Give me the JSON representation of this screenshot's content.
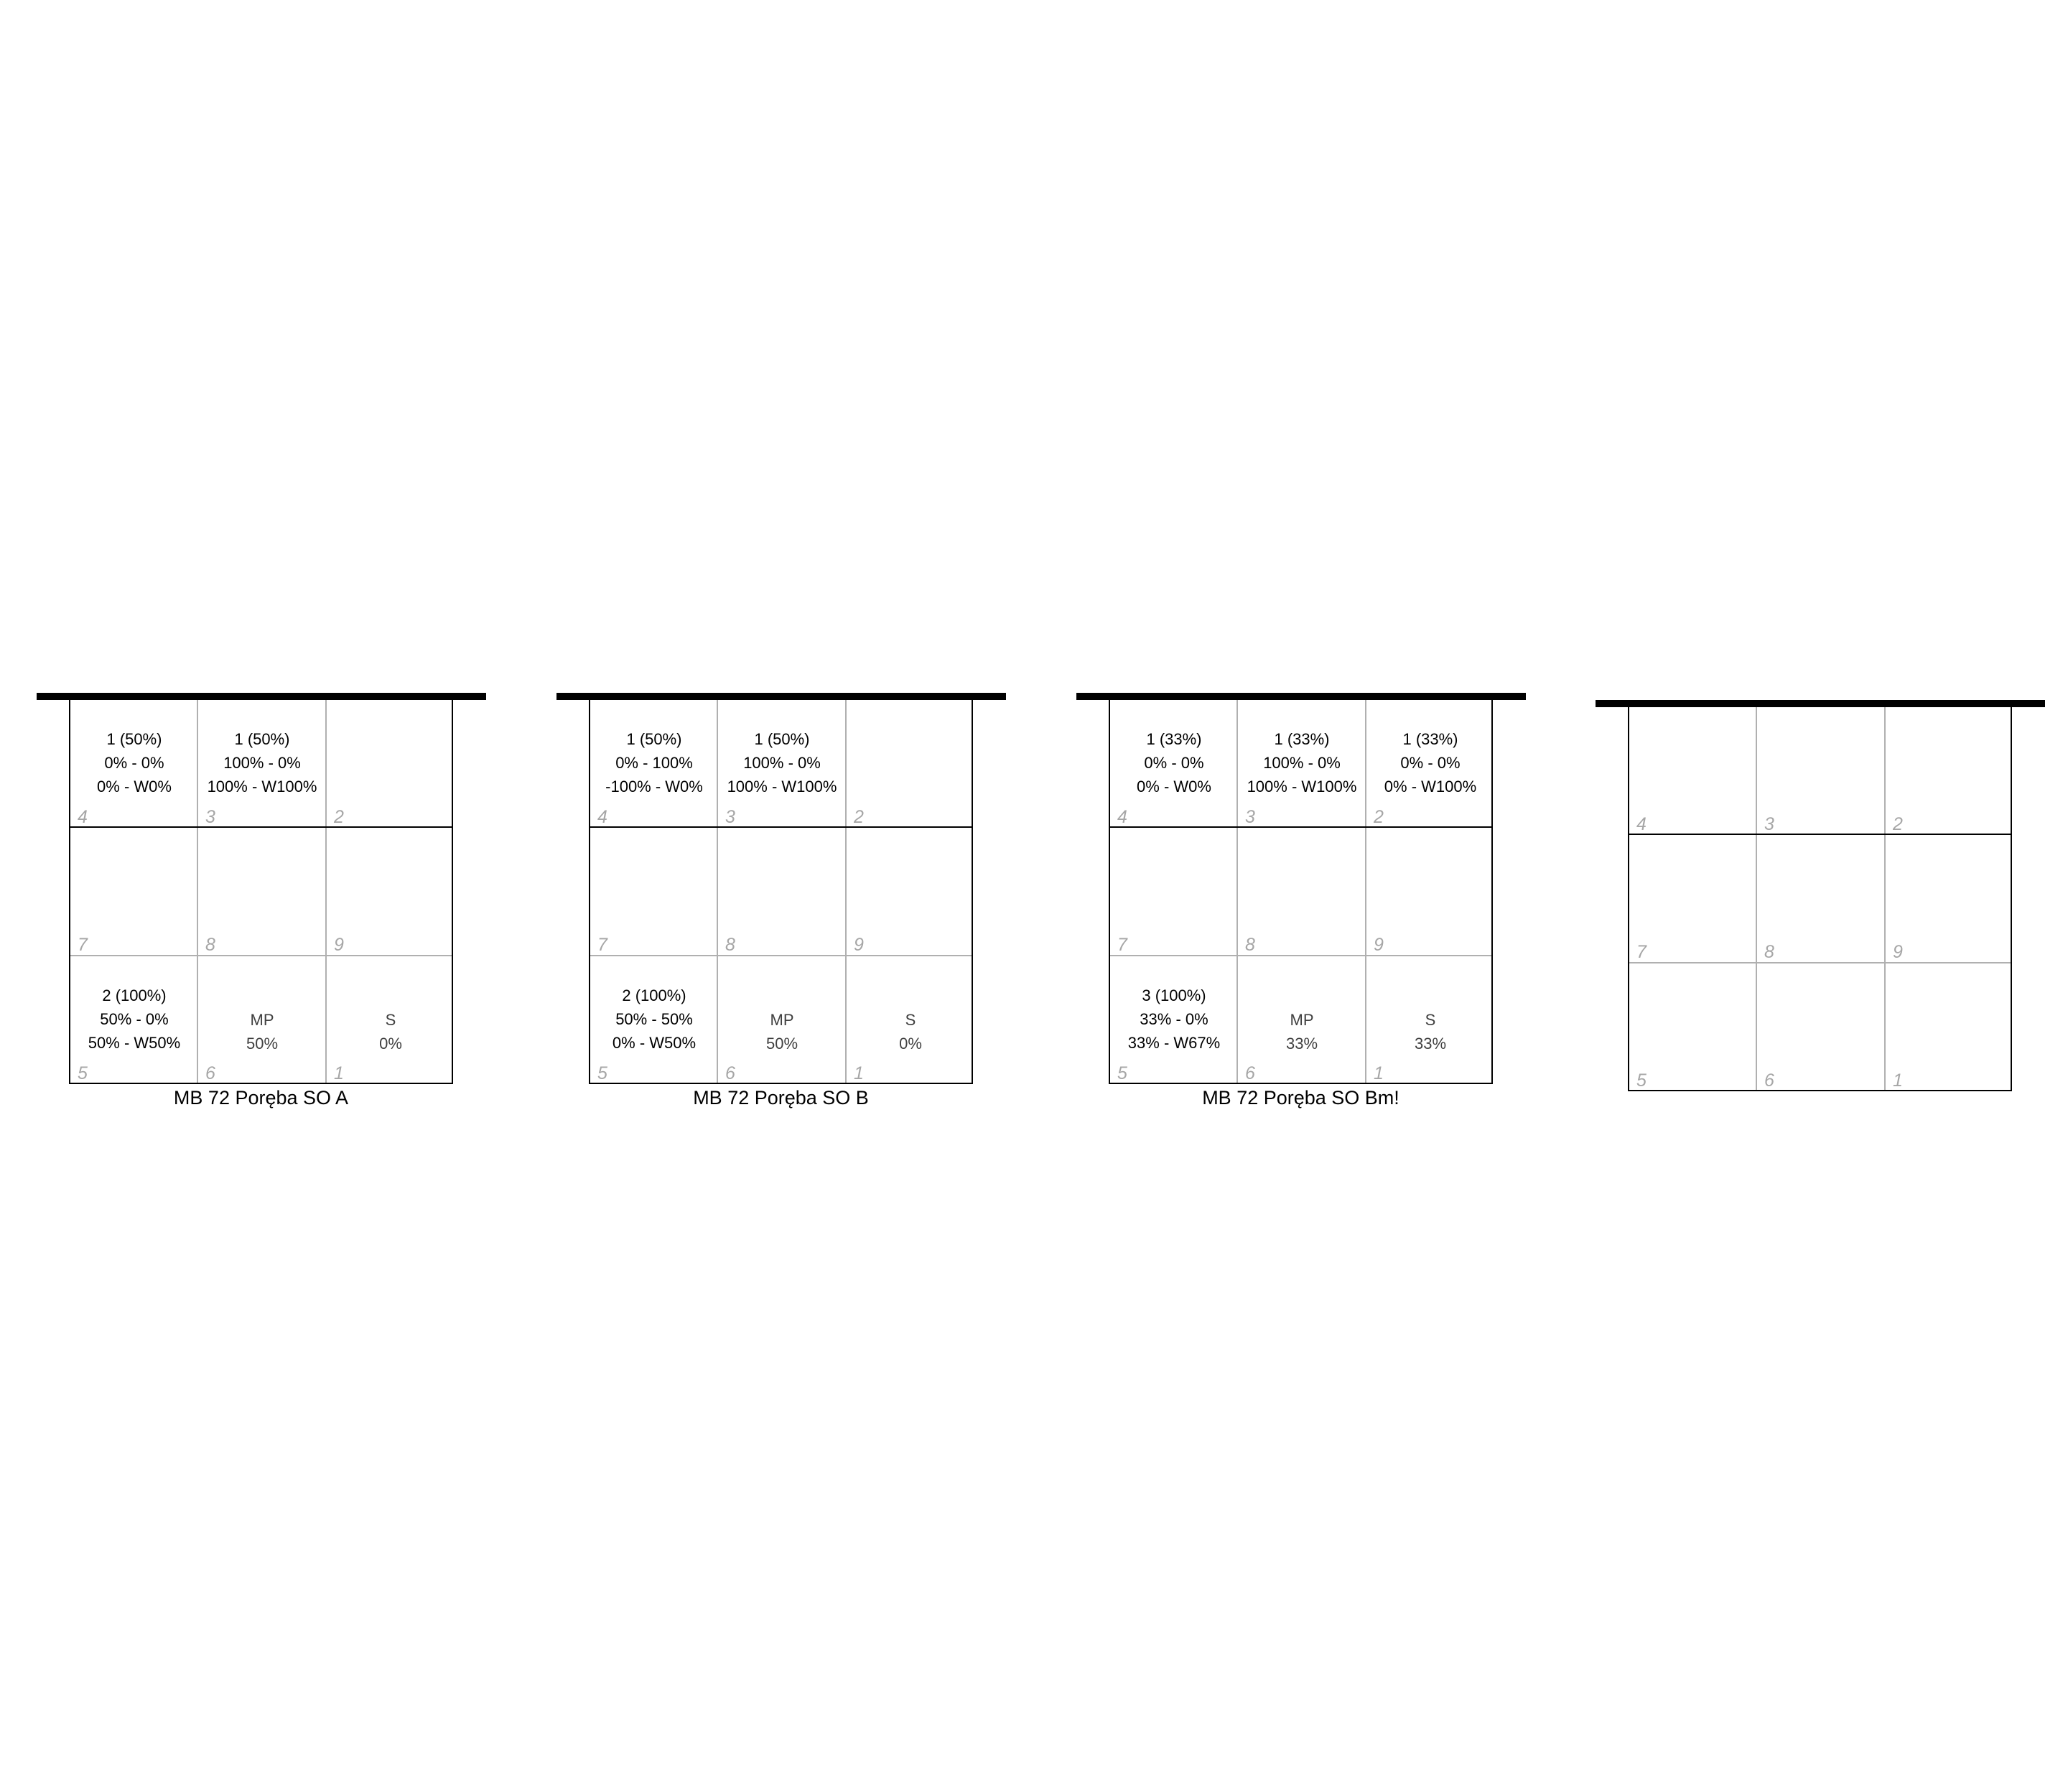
{
  "courts": [
    {
      "label": "MB 72 Poręba SO A",
      "zones": {
        "z4": {
          "num": "4",
          "l1": "1 (50%)",
          "l2": "0% - 0%",
          "l3": "0% - W0%"
        },
        "z3": {
          "num": "3",
          "l1": "1 (50%)",
          "l2": "100% - 0%",
          "l3": "100% - W100%"
        },
        "z2": {
          "num": "2",
          "l1": "",
          "l2": "",
          "l3": ""
        },
        "z7": {
          "num": "7"
        },
        "z8": {
          "num": "8"
        },
        "z9": {
          "num": "9"
        },
        "z5": {
          "num": "5",
          "l1": "2 (100%)",
          "l2": "50% - 0%",
          "l3": "50% - W50%"
        },
        "z6": {
          "num": "6",
          "label": "MP",
          "value": "50%"
        },
        "z1": {
          "num": "1",
          "label": "S",
          "value": "0%"
        }
      }
    },
    {
      "label": "MB 72 Poręba SO B",
      "zones": {
        "z4": {
          "num": "4",
          "l1": "1 (50%)",
          "l2": "0% - 100%",
          "l3": "-100% - W0%"
        },
        "z3": {
          "num": "3",
          "l1": "1 (50%)",
          "l2": "100% - 0%",
          "l3": "100% - W100%"
        },
        "z2": {
          "num": "2",
          "l1": "",
          "l2": "",
          "l3": ""
        },
        "z7": {
          "num": "7"
        },
        "z8": {
          "num": "8"
        },
        "z9": {
          "num": "9"
        },
        "z5": {
          "num": "5",
          "l1": "2 (100%)",
          "l2": "50% - 50%",
          "l3": "0% - W50%"
        },
        "z6": {
          "num": "6",
          "label": "MP",
          "value": "50%"
        },
        "z1": {
          "num": "1",
          "label": "S",
          "value": "0%"
        }
      }
    },
    {
      "label": "MB 72 Poręba SO Bm!",
      "zones": {
        "z4": {
          "num": "4",
          "l1": "1 (33%)",
          "l2": "0% - 0%",
          "l3": "0% - W0%"
        },
        "z3": {
          "num": "3",
          "l1": "1 (33%)",
          "l2": "100% - 0%",
          "l3": "100% - W100%"
        },
        "z2": {
          "num": "2",
          "l1": "1 (33%)",
          "l2": "0% - 0%",
          "l3": "0% - W100%"
        },
        "z7": {
          "num": "7"
        },
        "z8": {
          "num": "8"
        },
        "z9": {
          "num": "9"
        },
        "z5": {
          "num": "5",
          "l1": "3 (100%)",
          "l2": "33% - 0%",
          "l3": "33% - W67%"
        },
        "z6": {
          "num": "6",
          "label": "MP",
          "value": "33%"
        },
        "z1": {
          "num": "1",
          "label": "S",
          "value": "33%"
        }
      }
    },
    {
      "label": "",
      "zones": {
        "z4": {
          "num": "4"
        },
        "z3": {
          "num": "3"
        },
        "z2": {
          "num": "2"
        },
        "z7": {
          "num": "7"
        },
        "z8": {
          "num": "8"
        },
        "z9": {
          "num": "9"
        },
        "z5": {
          "num": "5"
        },
        "z6": {
          "num": "6"
        },
        "z1": {
          "num": "1"
        }
      }
    }
  ]
}
